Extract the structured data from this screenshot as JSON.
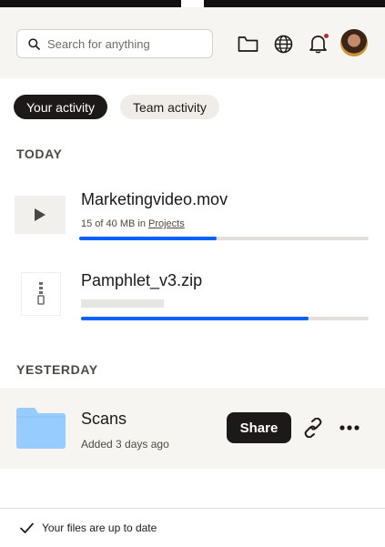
{
  "search": {
    "placeholder": "Search for anything"
  },
  "header": {
    "icons": [
      "search-icon",
      "folder-icon",
      "globe-icon",
      "bell-icon",
      "avatar"
    ],
    "notification_dot_color": "#c1292e"
  },
  "tabs": [
    {
      "label": "Your activity",
      "active": true
    },
    {
      "label": "Team activity",
      "active": false
    }
  ],
  "sections": {
    "today": "TODAY",
    "yesterday": "YESTERDAY"
  },
  "files": {
    "video": {
      "name": "Marketingvideo.mov",
      "progress_text": "15 of 40 MB in ",
      "folder": "Projects",
      "progress": 0.476,
      "icon": "play-icon"
    },
    "zip": {
      "name": "Pamphlet_v3.zip",
      "progress": 0.79,
      "icon": "zip-icon"
    },
    "scans": {
      "name": "Scans",
      "meta": "Added 3 days ago",
      "icon": "folder-icon",
      "folder_color": "#96ccff",
      "share_label": "Share"
    }
  },
  "status": {
    "text": "Your files are up to date"
  },
  "colors": {
    "accent": "#0061fe",
    "dark": "#1e1919",
    "header_bg": "#f7f5f2"
  }
}
